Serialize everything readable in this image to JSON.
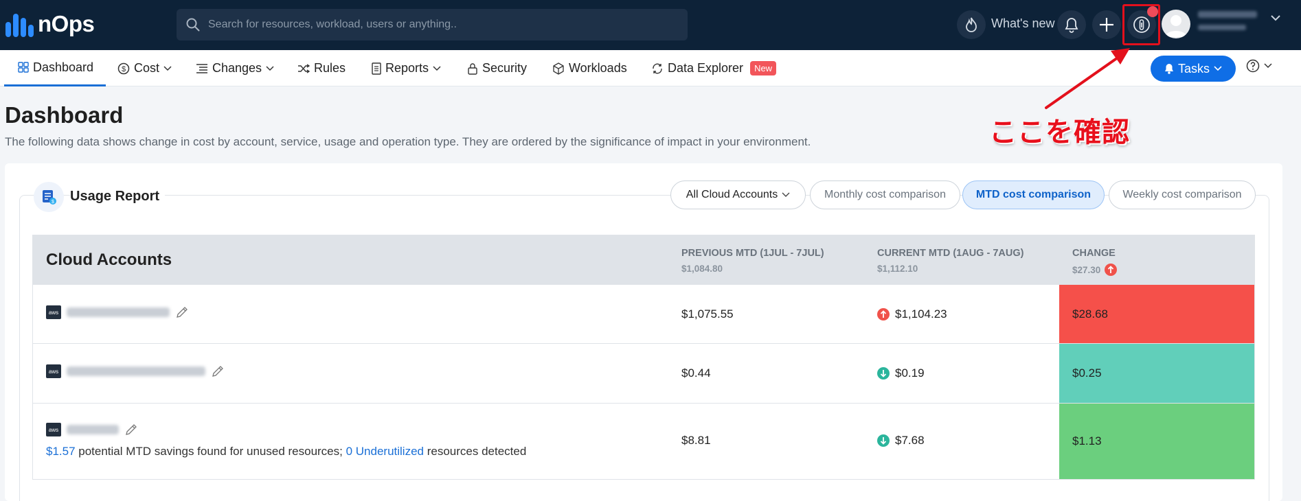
{
  "brand": {
    "name": "nOps"
  },
  "search": {
    "placeholder": "Search for resources, workload, users or anything.."
  },
  "topbar": {
    "whats_new": "What's new"
  },
  "nav": {
    "items": [
      {
        "label": "Dashboard",
        "icon": "grid-icon",
        "dropdown": false,
        "active": true
      },
      {
        "label": "Cost",
        "icon": "dollar-icon",
        "dropdown": true
      },
      {
        "label": "Changes",
        "icon": "list-icon",
        "dropdown": true
      },
      {
        "label": "Rules",
        "icon": "shuffle-icon",
        "dropdown": false
      },
      {
        "label": "Reports",
        "icon": "document-icon",
        "dropdown": true
      },
      {
        "label": "Security",
        "icon": "lock-icon",
        "dropdown": false
      },
      {
        "label": "Workloads",
        "icon": "cube-icon",
        "dropdown": false
      },
      {
        "label": "Data Explorer",
        "icon": "refresh-icon",
        "dropdown": false,
        "badge": "New"
      }
    ],
    "tasks_label": "Tasks"
  },
  "page": {
    "title": "Dashboard",
    "subtitle": "The following data shows change in cost by account, service, usage and operation type. They are ordered by the significance of impact in your environment."
  },
  "annotation": {
    "text": "ここを確認",
    "color": "#e8101c"
  },
  "report": {
    "title": "Usage Report",
    "filters": [
      {
        "label": "All Cloud Accounts",
        "dropdown": true,
        "active": false
      },
      {
        "label": "Monthly cost comparison",
        "active": false
      },
      {
        "label": "MTD cost comparison",
        "active": true
      },
      {
        "label": "Weekly cost comparison",
        "active": false
      }
    ]
  },
  "table": {
    "title": "Cloud Accounts",
    "columns": [
      {
        "label": "PREVIOUS MTD (1JUL - 7JUL)",
        "total": "$1,084.80"
      },
      {
        "label": "CURRENT MTD (1AUG - 7AUG)",
        "total": "$1,112.10"
      },
      {
        "label": "CHANGE",
        "total": "$27.30",
        "direction": "up"
      }
    ],
    "rows": [
      {
        "previous": "$1,075.55",
        "current": "$1,104.23",
        "direction": "up",
        "change": "$28.68",
        "change_color": "#f5504a"
      },
      {
        "previous": "$0.44",
        "current": "$0.19",
        "direction": "down",
        "change": "$0.25",
        "change_color": "#61cfba"
      },
      {
        "previous": "$8.81",
        "current": "$7.68",
        "direction": "down",
        "change": "$1.13",
        "change_color": "#6bcf7e",
        "savings": {
          "amount": "$1.57",
          "text1": " potential MTD savings found for unused resources; ",
          "underutilized": "0 Underutilized",
          "text2": " resources detected"
        }
      }
    ]
  },
  "colors": {
    "topbar": "#0d2238",
    "accent": "#1a6fd6",
    "tasks": "#0f6ee6",
    "up": "#f0524a",
    "down": "#2bb59c"
  }
}
